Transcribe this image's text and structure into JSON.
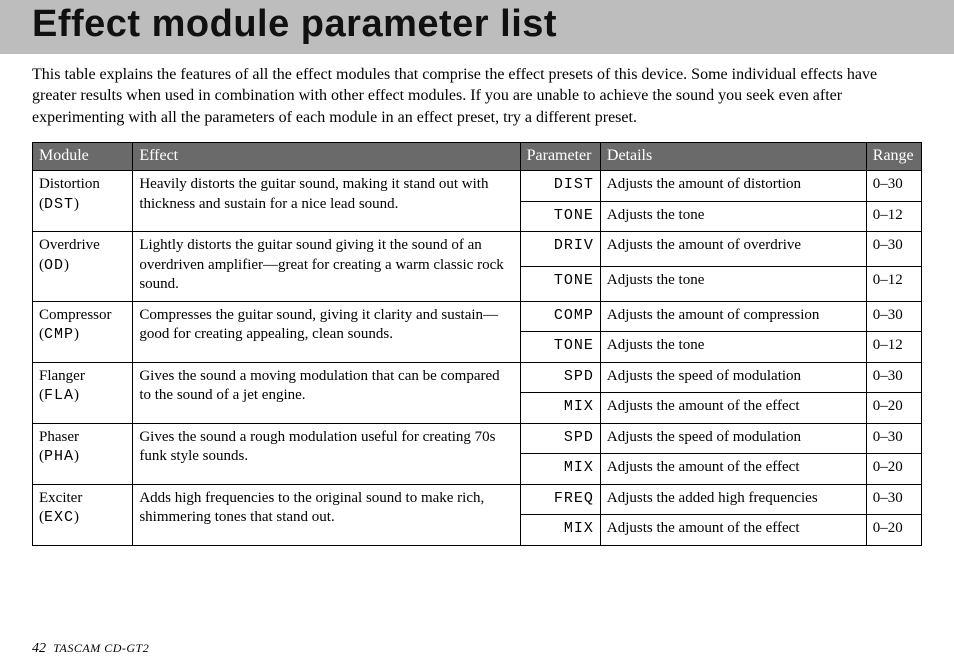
{
  "title": "Effect module parameter list",
  "intro": "This table explains the features of all the effect modules that comprise the effect presets of this device. Some individual effects have greater results when used in combination with other effect modules. If you are unable to achieve the sound you seek even after experimenting with all the parameters of each module in an effect preset, try a different preset.",
  "columns": {
    "module": "Module",
    "effect": "Effect",
    "parameter": "Parameter",
    "details": "Details",
    "range": "Range"
  },
  "rows": [
    {
      "module_name": "Distortion",
      "module_code": "DST",
      "effect": "Heavily distorts the guitar sound, making it stand out with thickness and sustain for a nice lead sound.",
      "params": [
        {
          "param": "DIST",
          "details": "Adjusts the amount of distortion",
          "range": "0–30"
        },
        {
          "param": "TONE",
          "details": "Adjusts the tone",
          "range": "0–12"
        }
      ]
    },
    {
      "module_name": "Overdrive",
      "module_code": "OD",
      "effect": "Lightly distorts the guitar sound giving it the sound of an overdriven amplifier—great for creating a warm classic rock sound.",
      "params": [
        {
          "param": "DRIV",
          "details": "Adjusts the amount of overdrive",
          "range": "0–30"
        },
        {
          "param": "TONE",
          "details": "Adjusts the tone",
          "range": "0–12"
        }
      ]
    },
    {
      "module_name": "Compressor",
      "module_code": "CMP",
      "effect": "Compresses the guitar sound, giving it clarity and sustain—good for creating appealing, clean sounds.",
      "params": [
        {
          "param": "COMP",
          "details": "Adjusts the amount of compression",
          "range": "0–30"
        },
        {
          "param": "TONE",
          "details": "Adjusts the tone",
          "range": "0–12"
        }
      ]
    },
    {
      "module_name": "Flanger",
      "module_code": "FLA",
      "effect": "Gives the sound a moving modulation that can be compared to the sound of a jet engine.",
      "params": [
        {
          "param": "SPD",
          "details": "Adjusts the speed of modulation",
          "range": "0–30"
        },
        {
          "param": "MIX",
          "details": "Adjusts the amount of the effect",
          "range": "0–20"
        }
      ]
    },
    {
      "module_name": "Phaser",
      "module_code": "PHA",
      "effect": "Gives the sound a rough modulation useful for creating 70s funk style sounds.",
      "params": [
        {
          "param": "SPD",
          "details": "Adjusts the speed of modulation",
          "range": "0–30"
        },
        {
          "param": "MIX",
          "details": "Adjusts the amount of the effect",
          "range": "0–20"
        }
      ]
    },
    {
      "module_name": "Exciter",
      "module_code": "EXC",
      "effect": "Adds high frequencies to the original sound to make rich, shimmering tones that stand out.",
      "params": [
        {
          "param": "FREQ",
          "details": "Adjusts the added high frequencies",
          "range": "0–30"
        },
        {
          "param": "MIX",
          "details": "Adjusts the amount of the effect",
          "range": "0–20"
        }
      ]
    }
  ],
  "footer": {
    "page_number": "42",
    "product": "TASCAM  CD-GT2"
  }
}
